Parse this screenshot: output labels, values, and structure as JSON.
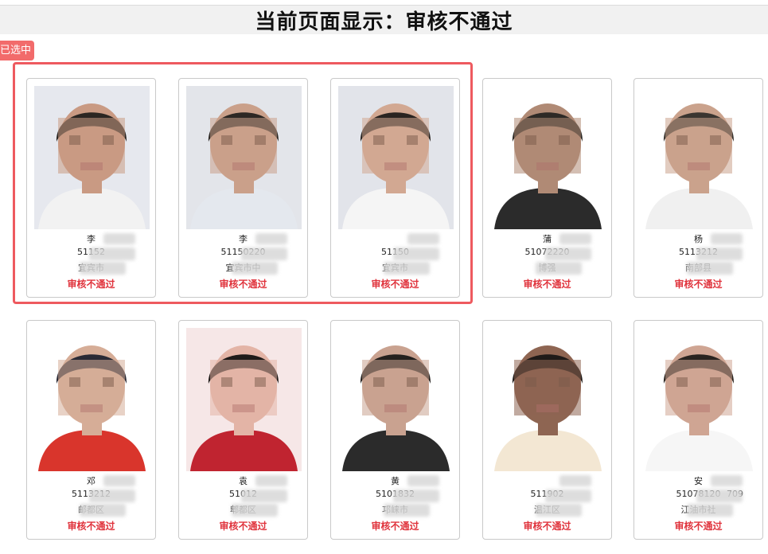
{
  "header": {
    "title": "当前页面显示：审核不通过"
  },
  "selection": {
    "tag": "已选中"
  },
  "cards": [
    {
      "name": "李",
      "id": "51152",
      "school": "宜宾市",
      "status": "审核不通过",
      "skin": "#c99a83",
      "hair": "#2b2622",
      "bg": "#e6e8ee",
      "shirt": "#f2f2f2"
    },
    {
      "name": "李",
      "id": "51150220",
      "school": "宜宾市中",
      "status": "审核不通过",
      "skin": "#caa08a",
      "hair": "#2d2824",
      "bg": "#e3e5ea",
      "shirt": "#e4e8ee"
    },
    {
      "name": "",
      "id": "51150",
      "school": "宜宾市",
      "status": "审核不通过",
      "skin": "#d2a892",
      "hair": "#2a2421",
      "bg": "#e2e4ea",
      "shirt": "#f5f5f5"
    },
    {
      "name": "蒲",
      "id": "51072220",
      "school": "博强",
      "status": "审核不通过",
      "skin": "#b08a75",
      "hair": "#2e2a26",
      "bg": "#ffffff",
      "shirt": "#2b2b2b"
    },
    {
      "name": "杨",
      "id": "5113212",
      "school": "南部县",
      "status": "审核不通过",
      "skin": "#caa28c",
      "hair": "#3a3530",
      "bg": "#ffffff",
      "shirt": "#f0f0f0"
    },
    {
      "name": "邓",
      "id": "5113212",
      "school": "邮都区",
      "status": "审核不通过",
      "skin": "#d6ad97",
      "hair": "#2a2a35",
      "bg": "#ffffff",
      "shirt": "#d9352c"
    },
    {
      "name": "袁",
      "id": "51012",
      "school": "郫都区",
      "status": "审核不通过",
      "skin": "#e3b4a6",
      "hair": "#1f1a18",
      "bg": "#f6e7e7",
      "shirt": "#c02430"
    },
    {
      "name": "黄",
      "id": "5101832",
      "school": "邛崃市",
      "status": "审核不通过",
      "skin": "#c9a290",
      "hair": "#25211e",
      "bg": "#ffffff",
      "shirt": "#2b2b2b"
    },
    {
      "name": "",
      "id": "511902",
      "school": "温江区",
      "status": "审核不通过",
      "skin": "#8e6552",
      "hair": "#201b19",
      "bg": "#ffffff",
      "shirt": "#f3e7d3"
    },
    {
      "name": "安",
      "id": "51078120",
      "id2": "709",
      "school": "江油市社",
      "status": "审核不通过",
      "skin": "#cfa593",
      "hair": "#2a2420",
      "bg": "#ffffff",
      "shirt": "#f6f6f6"
    }
  ]
}
